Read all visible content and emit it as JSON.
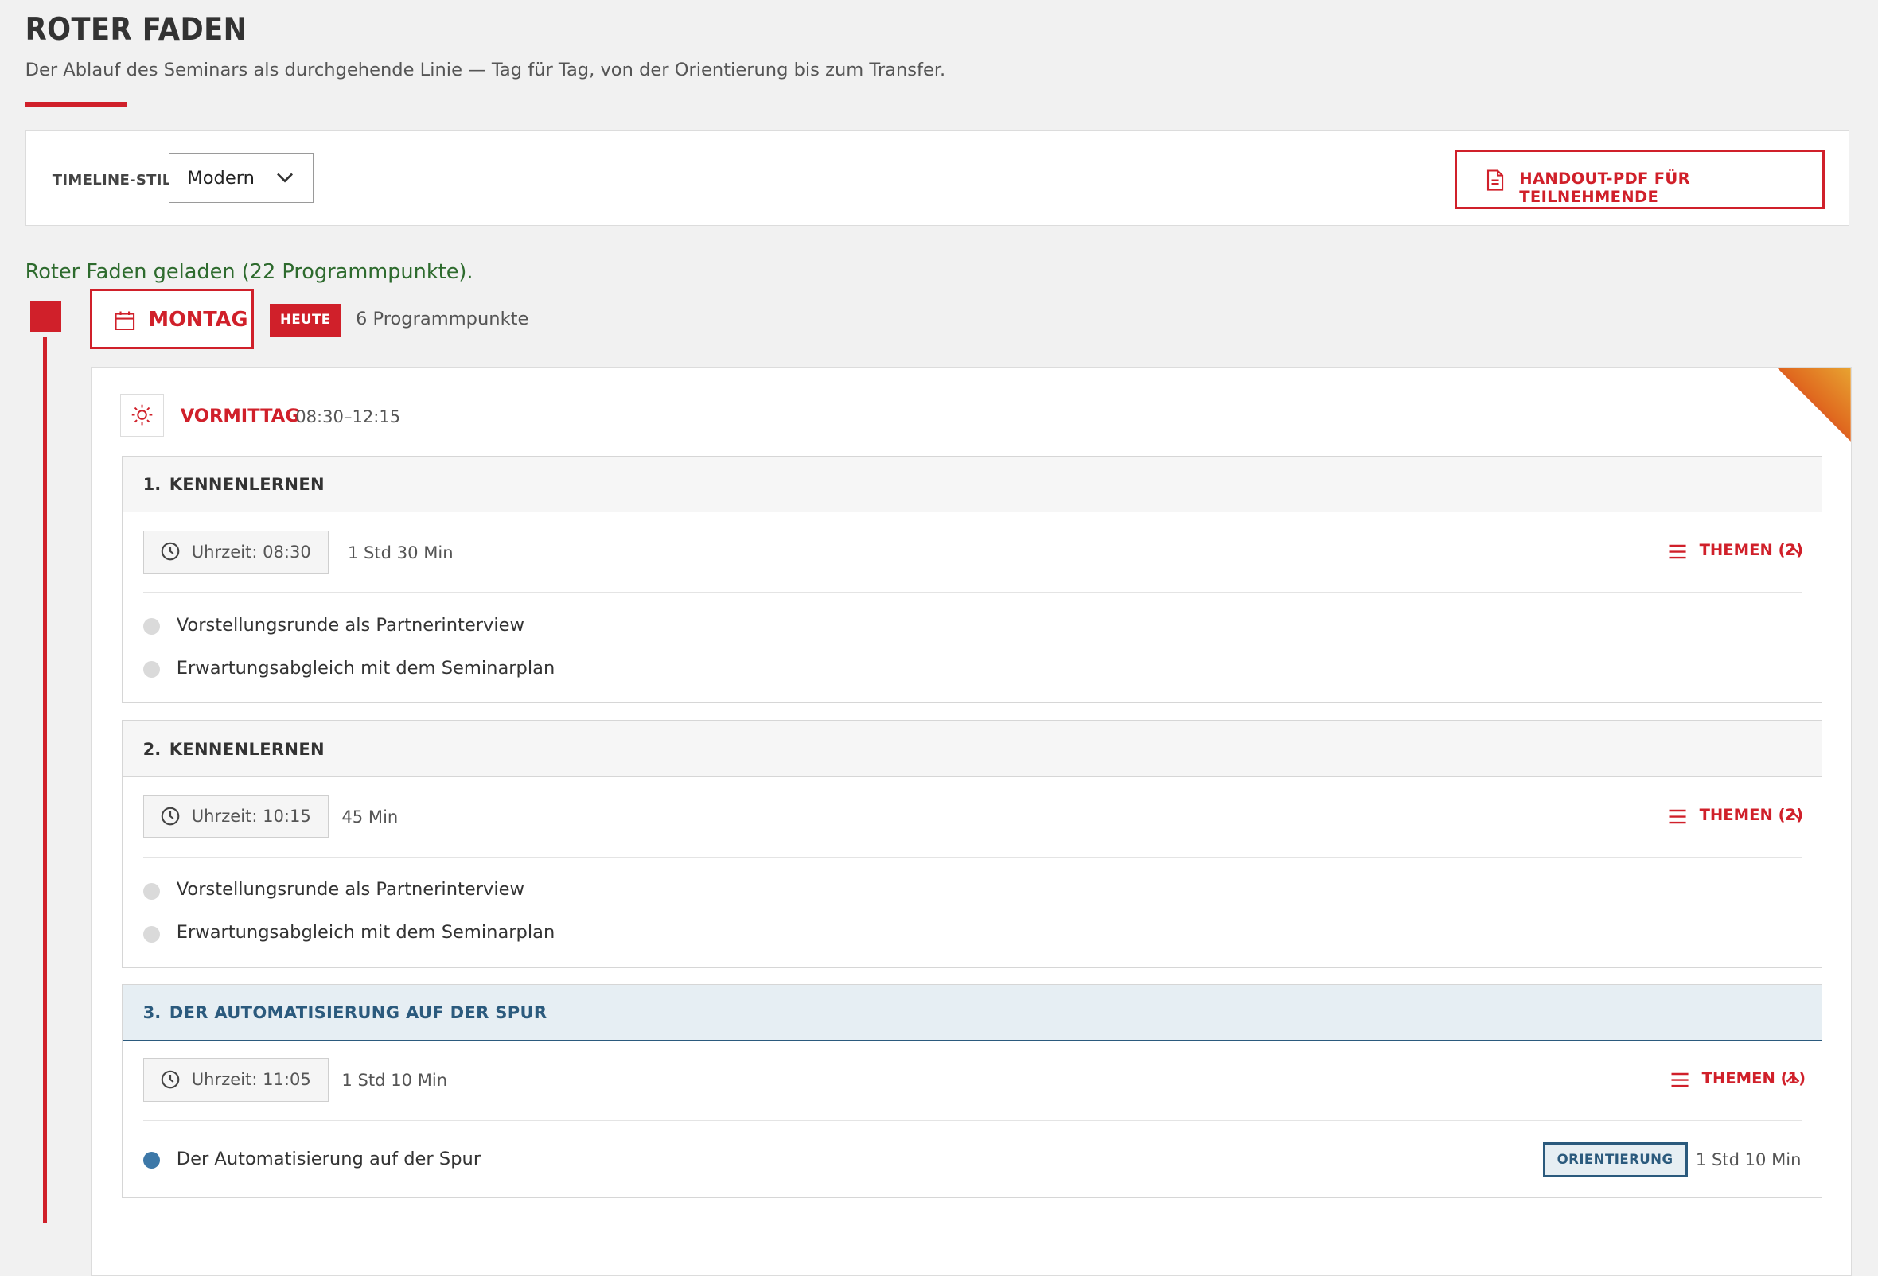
{
  "page": {
    "title": "ROTER FADEN",
    "subtitle": "Der Ablauf des Seminars als durchgehende Linie — Tag für Tag, von der Orientierung bis zum Transfer."
  },
  "toolbar": {
    "style_label": "TIMELINE-STIL",
    "style_value": "Modern",
    "handout_label": "HANDOUT-PDF FÜR TEILNEHMENDE"
  },
  "status": "Roter Faden geladen (22 Programmpunkte).",
  "colors": {
    "accent": "#d0202a",
    "status_green": "#2e6b2e",
    "tag_blue": "#2b5a7d"
  },
  "day": {
    "label": "MONTAG",
    "badge": "HEUTE",
    "count": "6 Programmpunkte",
    "period": {
      "label": "VORMITTAG",
      "time": "08:30–12:15",
      "icon": "sun-icon"
    },
    "items": [
      {
        "num": "1.",
        "title": "KENNENLERNEN",
        "time": "Uhrzeit: 08:30",
        "duration": "1 Std 30 Min",
        "themes": "THEMEN (2)",
        "topics": [
          {
            "text": "Vorstellungsrunde als Partnerinterview"
          },
          {
            "text": "Erwartungsabgleich mit dem Seminarplan"
          }
        ]
      },
      {
        "num": "2.",
        "title": "KENNENLERNEN",
        "time": "Uhrzeit: 10:15",
        "duration": "45 Min",
        "themes": "THEMEN (2)",
        "topics": [
          {
            "text": "Vorstellungsrunde als Partnerinterview"
          },
          {
            "text": "Erwartungsabgleich mit dem Seminarplan"
          }
        ]
      },
      {
        "num": "3.",
        "title": "DER AUTOMATISIERUNG AUF DER SPUR",
        "time": "Uhrzeit: 11:05",
        "duration": "1 Std 10 Min",
        "themes": "THEMEN (1)",
        "topics": [
          {
            "text": "Der Automatisierung auf der Spur",
            "tag": "ORIENTIERUNG",
            "duration": "1 Std 10 Min"
          }
        ]
      }
    ]
  }
}
